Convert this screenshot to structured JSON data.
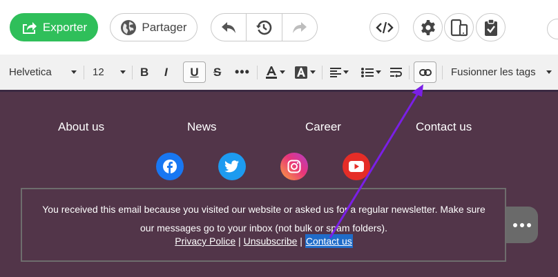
{
  "toolbar": {
    "export_label": "Exporter",
    "share_label": "Partager"
  },
  "formatbar": {
    "font_family": "Helvetica",
    "font_size": "12",
    "merge_tags_label": "Fusionner les tags"
  },
  "footer": {
    "nav": [
      "About us",
      "News",
      "Career",
      "Contact us"
    ],
    "notice_line1": "You received this email because you visited our website or asked us for a regular newsletter. Make sure",
    "notice_line2": "our messages go to your inbox (not bulk or spam folders).",
    "links": {
      "privacy": "Privacy Police",
      "sep1": "|",
      "unsubscribe": "Unsubscribe",
      "sep2": "|",
      "contact": "Contact us"
    }
  },
  "colors": {
    "export_green": "#2fbf5a",
    "footer_bg": "#523549",
    "arrow": "#7a1fe6",
    "selection": "#1f6cc9"
  },
  "icons": {
    "export": "export-icon",
    "share": "globe-icon",
    "undo": "undo-icon",
    "history": "history-icon",
    "redo": "redo-icon",
    "code": "code-icon",
    "settings": "gear-icon",
    "preview": "device-preview-icon",
    "clipboard": "clipboard-check-icon",
    "link": "link-icon",
    "facebook": "facebook-icon",
    "twitter": "twitter-icon",
    "instagram": "instagram-icon",
    "youtube": "youtube-icon"
  }
}
